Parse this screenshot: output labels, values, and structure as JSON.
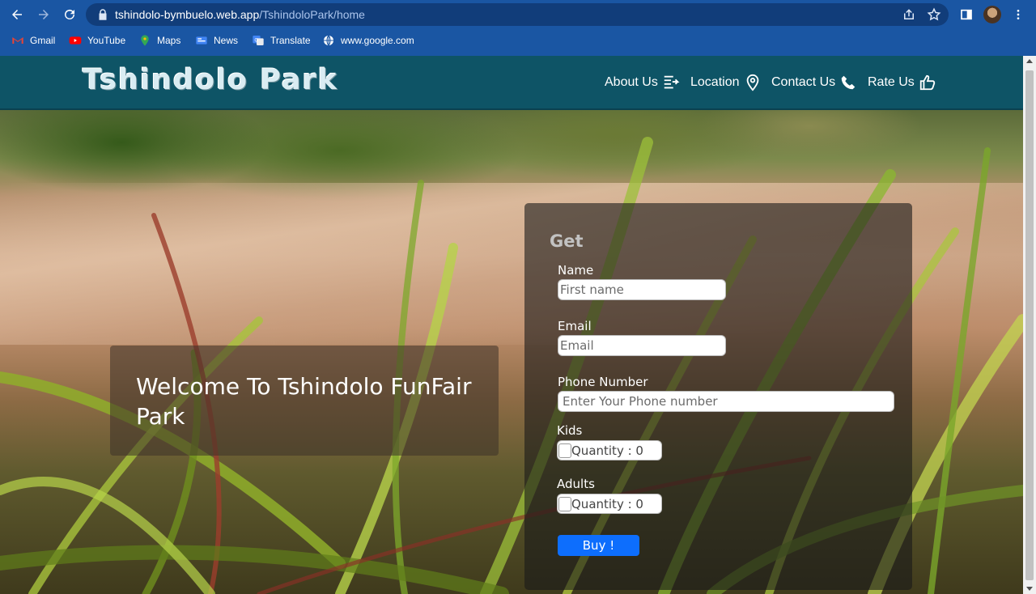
{
  "browser": {
    "url_host": "tshindolo-bymbuelo.web.app",
    "url_path": "/TshindoloPark/home",
    "bookmarks": [
      {
        "label": "Gmail",
        "icon": "gmail-icon"
      },
      {
        "label": "YouTube",
        "icon": "youtube-icon"
      },
      {
        "label": "Maps",
        "icon": "maps-icon"
      },
      {
        "label": "News",
        "icon": "news-icon"
      },
      {
        "label": "Translate",
        "icon": "translate-icon"
      },
      {
        "label": "www.google.com",
        "icon": "globe-icon"
      }
    ],
    "colors": {
      "frame": "#1a56a3",
      "omnibox": "#113d7a"
    }
  },
  "site": {
    "logo": "Tshindolo Park",
    "nav": [
      {
        "label": "About Us",
        "icon": "document-arrow-icon"
      },
      {
        "label": "Location",
        "icon": "map-pin-icon"
      },
      {
        "label": "Contact Us",
        "icon": "phone-icon"
      },
      {
        "label": "Rate Us",
        "icon": "thumbs-up-icon"
      }
    ],
    "colors": {
      "header": "#0e5466",
      "buy_button": "#0d6efd"
    }
  },
  "hero": {
    "welcome": "Welcome To Tshindolo FunFair Park"
  },
  "form": {
    "heading": "Get",
    "name_label": "Name",
    "name_placeholder": "First name",
    "email_label": "Email",
    "email_placeholder": "Email",
    "phone_label": "Phone Number",
    "phone_placeholder": "Enter Your Phone number",
    "kids_label": "Kids",
    "kids_quantity": "Quantity : 0",
    "adults_label": "Adults",
    "adults_quantity": "Quantity : 0",
    "buy_label": "Buy !"
  }
}
